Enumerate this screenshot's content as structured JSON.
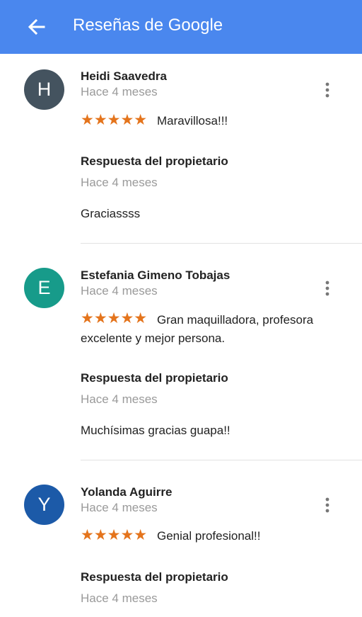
{
  "header": {
    "title": "Reseñas de Google",
    "color": "#4a87ee"
  },
  "reviews": [
    {
      "initial": "H",
      "avatar_color": "#44535f",
      "name": "Heidi Saavedra",
      "time": "Hace 4 meses",
      "rating": 5,
      "stars": "★★★★★",
      "text": "Maravillosa!!!",
      "response_title": "Respuesta del propietario",
      "response_time": "Hace 4 meses",
      "response_text": "Graciassss"
    },
    {
      "initial": "E",
      "avatar_color": "#179b8a",
      "name": "Estefania Gimeno Tobajas",
      "time": "Hace 4 meses",
      "rating": 5,
      "stars": "★★★★★",
      "text": "Gran maquilladora, profesora excelente y mejor persona.",
      "response_title": "Respuesta del propietario",
      "response_time": "Hace 4 meses",
      "response_text": "Muchísimas gracias guapa!!"
    },
    {
      "initial": "Y",
      "avatar_color": "#1c5aa8",
      "name": "Yolanda Aguirre",
      "time": "Hace 4 meses",
      "rating": 5,
      "stars": "★★★★★",
      "text": "Genial profesional!!",
      "response_title": "Respuesta del propietario",
      "response_time": "Hace 4 meses",
      "response_text": ""
    }
  ],
  "icons": {
    "back": "arrow-left-icon",
    "menu": "more-vert-icon",
    "star": "star-icon"
  },
  "colors": {
    "star": "#e4741c",
    "secondary_text": "#9a9a9a"
  }
}
